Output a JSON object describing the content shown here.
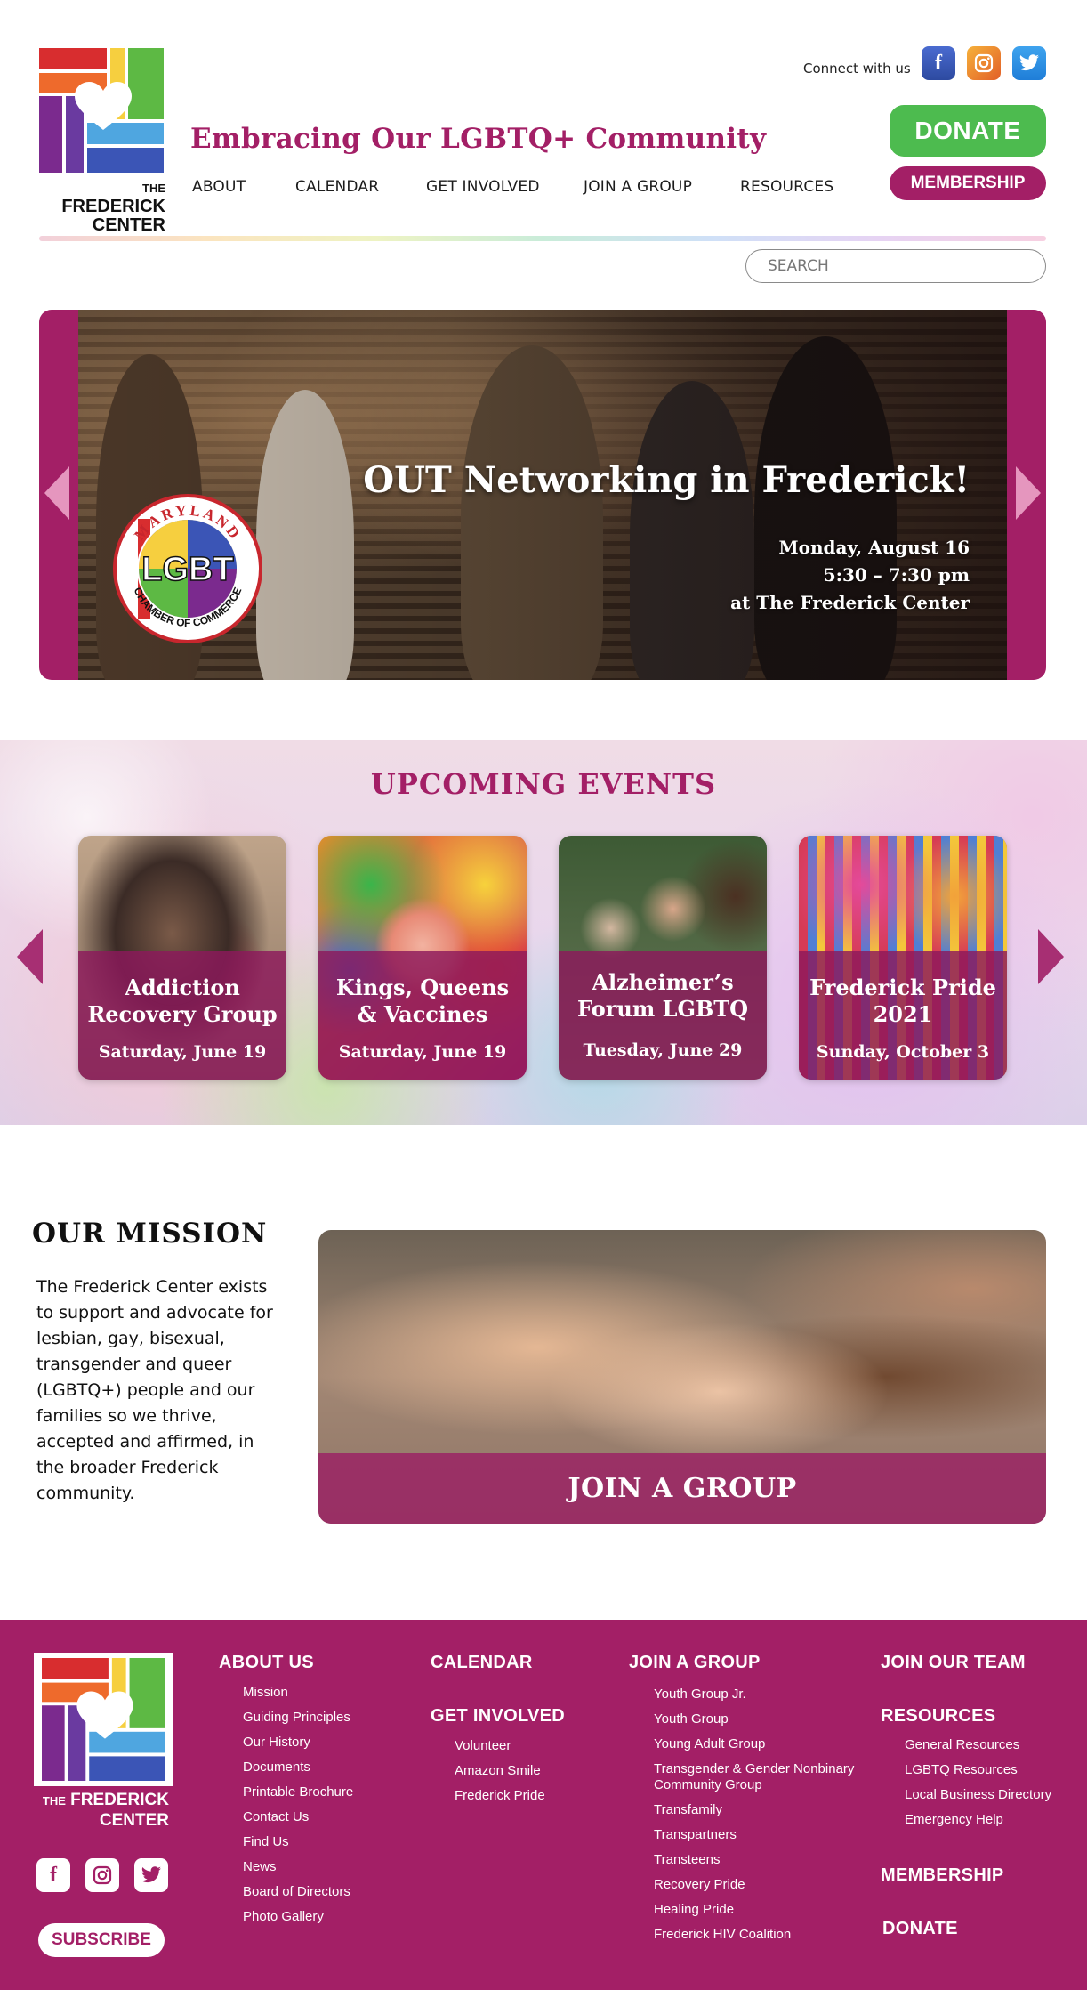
{
  "header": {
    "logo_the": "THE",
    "logo_name_1": "FREDERICK",
    "logo_name_2": "CENTER",
    "tagline": "Embracing Our LGBTQ+ Community",
    "connect_label": "Connect with us",
    "social": {
      "facebook": "f",
      "instagram": "instagram-icon",
      "twitter": "twitter-icon"
    },
    "donate_label": "DONATE",
    "membership_label": "MEMBERSHIP",
    "nav": [
      "ABOUT",
      "CALENDAR",
      "GET INVOLVED",
      "JOIN A GROUP",
      "RESOURCES"
    ],
    "search_placeholder": "SEARCH"
  },
  "hero": {
    "title": "OUT Networking in Frederick!",
    "date": "Monday, August 16",
    "time": "5:30 – 7:30 pm",
    "location": "at The Frederick Center",
    "badge_top": "MARYLAND",
    "badge_center": "LGBT",
    "badge_bottom": "CHAMBER OF COMMERCE"
  },
  "events": {
    "title": "UPCOMING EVENTS",
    "cards": [
      {
        "title": "Addiction Recovery Group",
        "date": "Saturday, June 19"
      },
      {
        "title": "Kings, Queens & Vaccines",
        "date": "Saturday, June 19"
      },
      {
        "title": "Alzheimer’s Forum LGBTQ",
        "date": "Tuesday, June 29"
      },
      {
        "title": "Frederick Pride 2021",
        "date": "Sunday, October 3"
      }
    ]
  },
  "mission": {
    "title": "OUR MISSION",
    "text": "The Frederick Center exists to support and advocate for lesbian, gay, bisexual, transgender and queer (LGBTQ+) people and our families so we thrive, accepted and affirmed, in the broader Frederick community.",
    "join_label": "JOIN A GROUP"
  },
  "footer": {
    "logo_the": "THE",
    "logo_name_1": "FREDERICK",
    "logo_name_2": "CENTER",
    "subscribe_label": "SUBSCRIBE",
    "about_head": "ABOUT US",
    "about_items": [
      "Mission",
      "Guiding Principles",
      "Our History",
      "Documents",
      "Printable Brochure",
      "Contact Us",
      "Find Us",
      "News",
      "Board of Directors",
      "Photo Gallery"
    ],
    "calendar_head": "CALENDAR",
    "involved_head": "GET INVOLVED",
    "involved_items": [
      "Volunteer",
      "Amazon Smile",
      "Frederick Pride"
    ],
    "group_head": "JOIN A GROUP",
    "group_items": [
      "Youth Group Jr.",
      "Youth Group",
      "Young Adult Group",
      "Transgender & Gender Nonbinary Community Group",
      "Transfamily",
      "Transpartners",
      "Transteens",
      "Recovery Pride",
      "Healing Pride",
      "Frederick HIV Coalition"
    ],
    "team_head": "JOIN OUR TEAM",
    "resources_head": "RESOURCES",
    "resources_items": [
      "General Resources",
      "LGBTQ Resources",
      "Local Business Directory",
      "Emergency Help"
    ],
    "membership_head": "MEMBERSHIP",
    "donate_head": "DONATE"
  },
  "colors": {
    "brand": "#a31f66",
    "donate": "#4dbb4f",
    "arrow": "#e596be"
  }
}
